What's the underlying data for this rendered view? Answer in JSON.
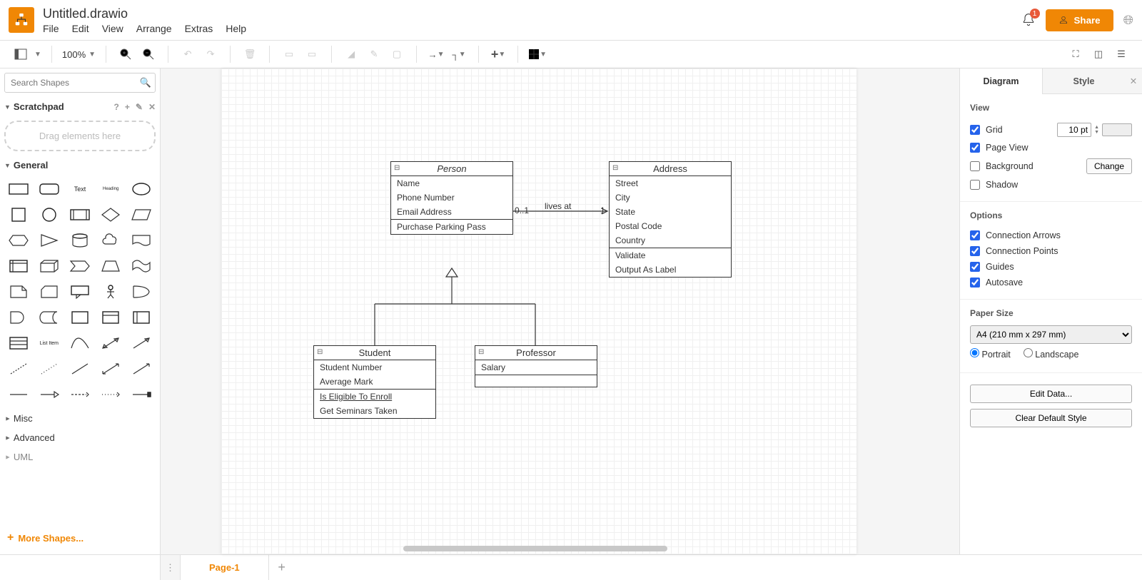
{
  "doc": {
    "title": "Untitled.drawio"
  },
  "menu": {
    "file": "File",
    "edit": "Edit",
    "view": "View",
    "arrange": "Arrange",
    "extras": "Extras",
    "help": "Help"
  },
  "topbar": {
    "share": "Share",
    "notif_count": "1"
  },
  "toolbar": {
    "zoom": "100%"
  },
  "sidebar": {
    "search_placeholder": "Search Shapes",
    "scratchpad_title": "Scratchpad",
    "scratchpad_hint": "Drag elements here",
    "general_title": "General",
    "misc_title": "Misc",
    "advanced_title": "Advanced",
    "uml_title": "UML",
    "more": "More Shapes...",
    "text_label": "Text",
    "heading_label": "Heading",
    "list_label": "List",
    "list_item_label": "List Item"
  },
  "canvas": {
    "person": {
      "title": "Person",
      "rows": [
        "Name",
        "Phone Number",
        "Email Address"
      ],
      "methods": [
        "Purchase Parking Pass"
      ]
    },
    "address": {
      "title": "Address",
      "rows": [
        "Street",
        "City",
        "State",
        "Postal Code",
        "Country"
      ],
      "methods": [
        "Validate",
        "Output As Label"
      ]
    },
    "student": {
      "title": "Student",
      "rows": [
        "Student Number",
        "Average Mark"
      ],
      "methods": [
        "Is Eligible To Enroll",
        "Get Seminars Taken"
      ]
    },
    "professor": {
      "title": "Professor",
      "rows": [
        "Salary"
      ]
    },
    "edge": {
      "left_mult": "0..1",
      "label": "lives at",
      "right_mult": "1"
    }
  },
  "right": {
    "tab_diagram": "Diagram",
    "tab_style": "Style",
    "view_title": "View",
    "grid": "Grid",
    "grid_size": "10 pt",
    "page_view": "Page View",
    "background": "Background",
    "change": "Change",
    "shadow": "Shadow",
    "options_title": "Options",
    "conn_arrows": "Connection Arrows",
    "conn_points": "Connection Points",
    "guides": "Guides",
    "autosave": "Autosave",
    "paper_title": "Paper Size",
    "paper_value": "A4 (210 mm x 297 mm)",
    "portrait": "Portrait",
    "landscape": "Landscape",
    "edit_data": "Edit Data...",
    "clear_style": "Clear Default Style"
  },
  "bottom": {
    "page": "Page-1"
  }
}
